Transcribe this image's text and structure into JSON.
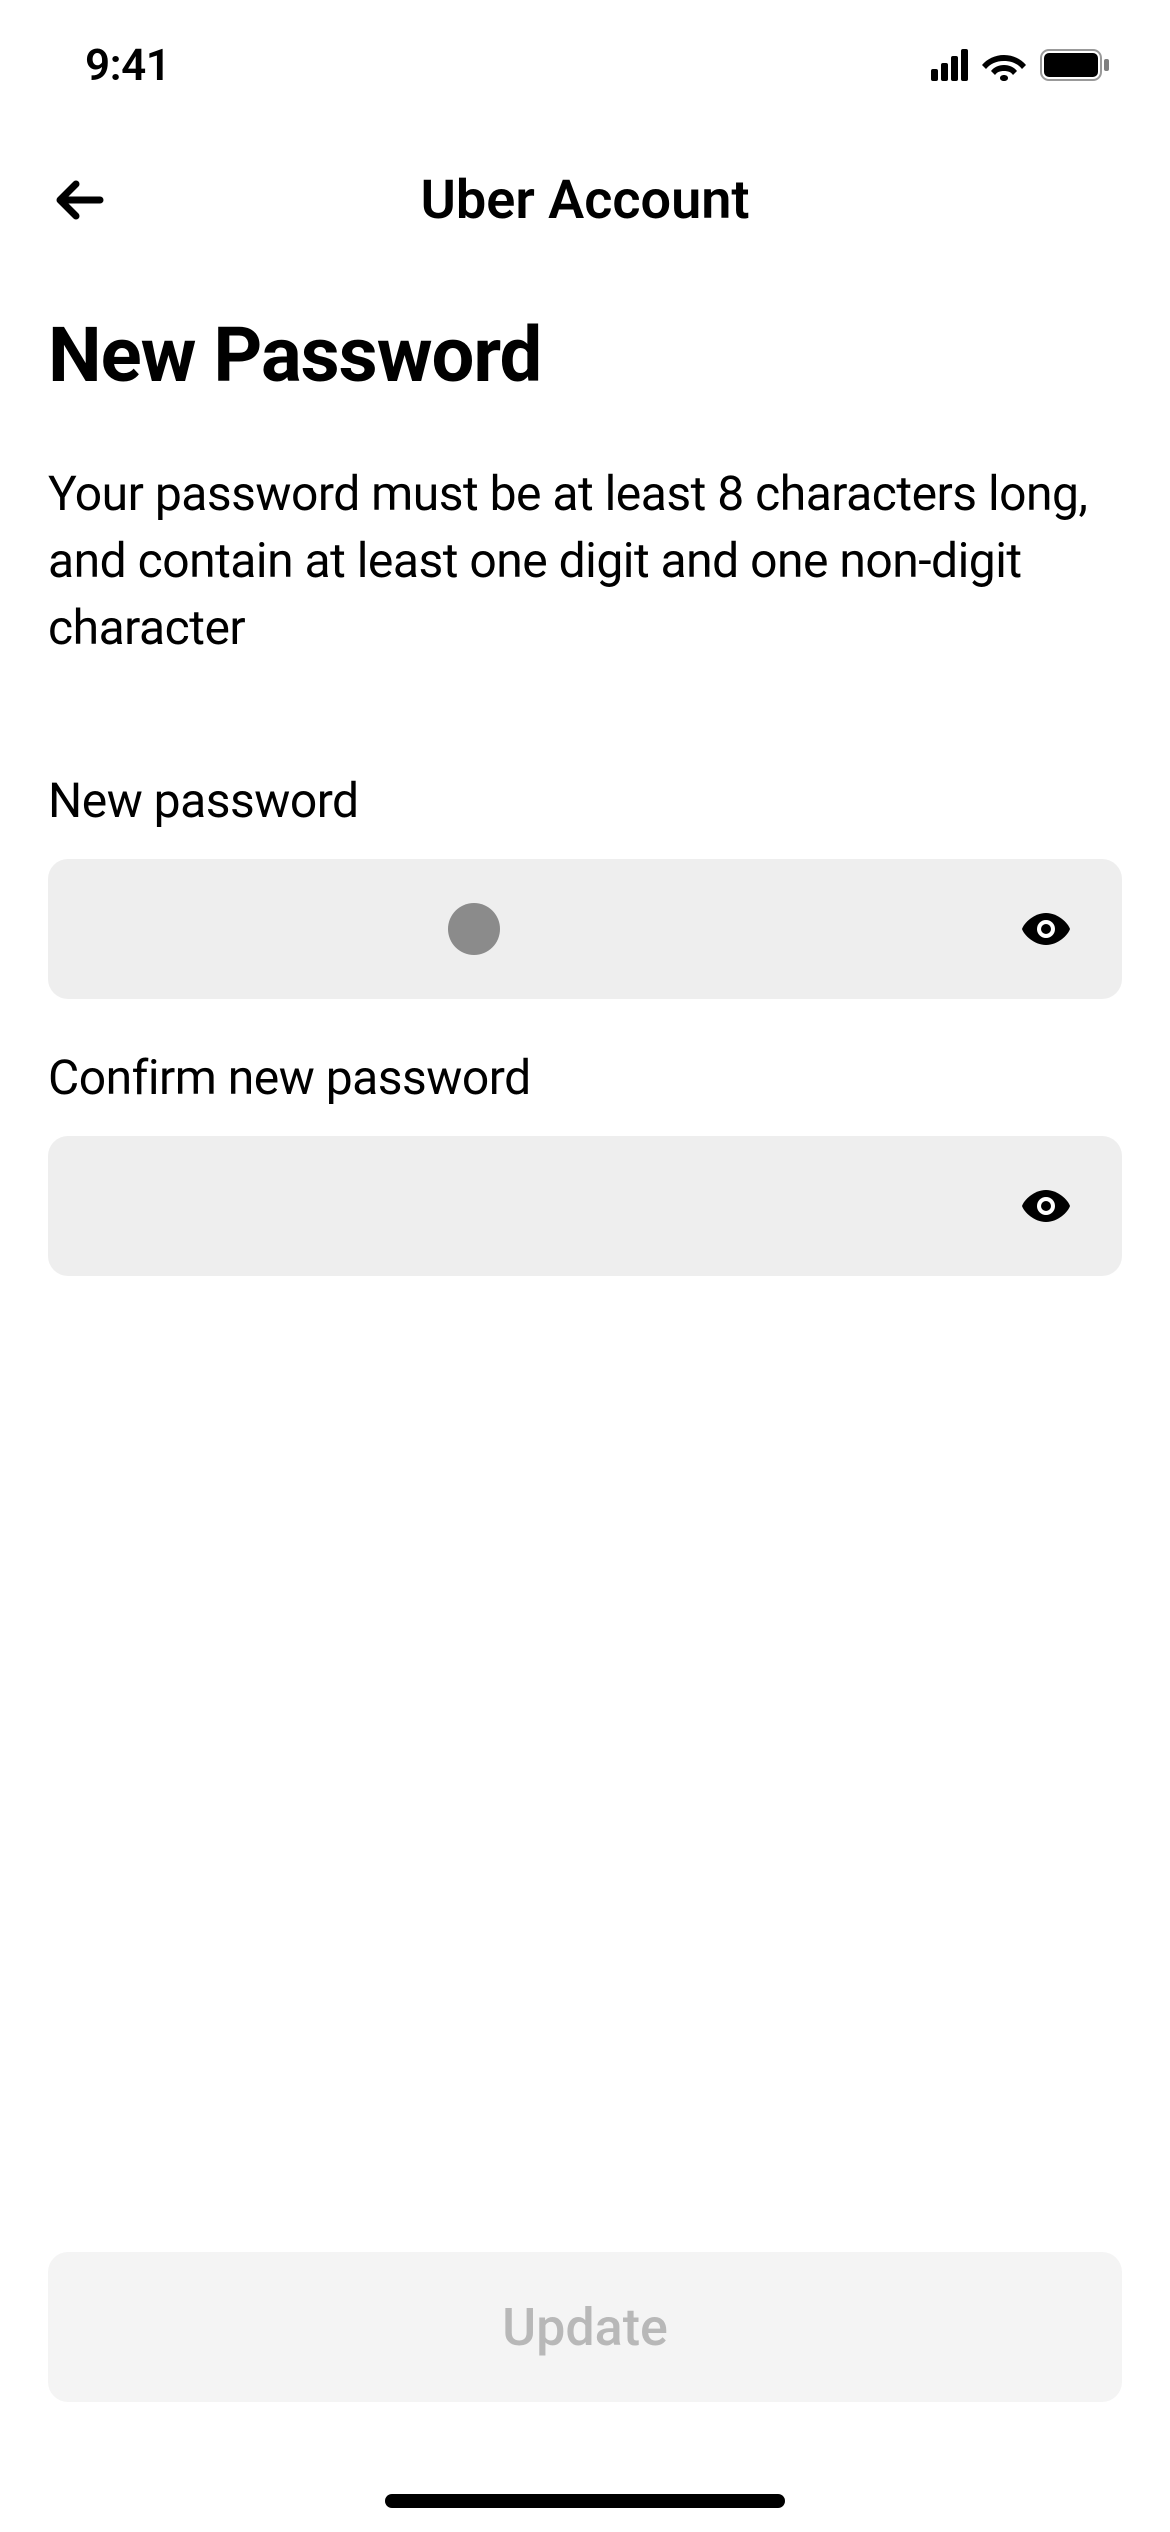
{
  "status_bar": {
    "time": "9:41"
  },
  "nav": {
    "title": "Uber Account"
  },
  "page": {
    "title": "New Password",
    "description": "Your password must be at least 8 characters long, and contain at least one digit and one non-digit character"
  },
  "fields": {
    "new_password": {
      "label": "New password",
      "has_value": true
    },
    "confirm_password": {
      "label": "Confirm new password",
      "has_value": false
    }
  },
  "button": {
    "update_label": "Update"
  }
}
